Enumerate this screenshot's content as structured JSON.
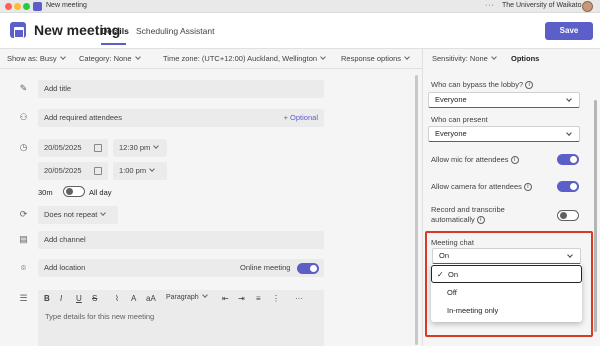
{
  "window": {
    "title": "New meeting",
    "org": "The University of Waikato",
    "menu_dots": "···"
  },
  "header": {
    "title": "New meeting",
    "tabs": [
      "Details",
      "Scheduling Assistant"
    ],
    "save_label": "Save"
  },
  "toolbar": {
    "show_as": "Show as: Busy",
    "category": "Category: None",
    "time_zone": "Time zone: (UTC+12:00) Auckland, Wellington",
    "response": "Response options"
  },
  "form": {
    "title_placeholder": "Add title",
    "attendees_placeholder": "Add required attendees",
    "optional_label": "+ Optional",
    "start_date": "20/05/2025",
    "start_time": "12:30 pm",
    "end_date": "20/05/2025",
    "end_time": "1:00 pm",
    "duration": "30m",
    "all_day_label": "All day",
    "repeat": "Does not repeat",
    "channel_placeholder": "Add channel",
    "location_placeholder": "Add location",
    "online_meeting_label": "Online meeting",
    "details_placeholder": "Type details for this new meeting"
  },
  "richtext": {
    "bold": "B",
    "italic": "I",
    "underline": "U",
    "strike": "S",
    "font_size": "aA",
    "paragraph": "Paragraph",
    "more": "···"
  },
  "options_panel": {
    "tabs": [
      "Sensitivity: None",
      "Options"
    ],
    "bypass_label": "Who can bypass the lobby?",
    "bypass_value": "Everyone",
    "present_label": "Who can present",
    "present_value": "Everyone",
    "mic_label": "Allow mic for attendees",
    "mic_on": true,
    "camera_label": "Allow camera for attendees",
    "camera_on": true,
    "record_label_1": "Record and transcribe",
    "record_label_2": "automatically",
    "record_on": false,
    "chat_label": "Meeting chat",
    "chat_value": "On",
    "chat_options": [
      "On",
      "Off",
      "In-meeting only"
    ]
  },
  "colors": {
    "accent": "#5b5fc7",
    "highlight_border": "#d93a25"
  }
}
